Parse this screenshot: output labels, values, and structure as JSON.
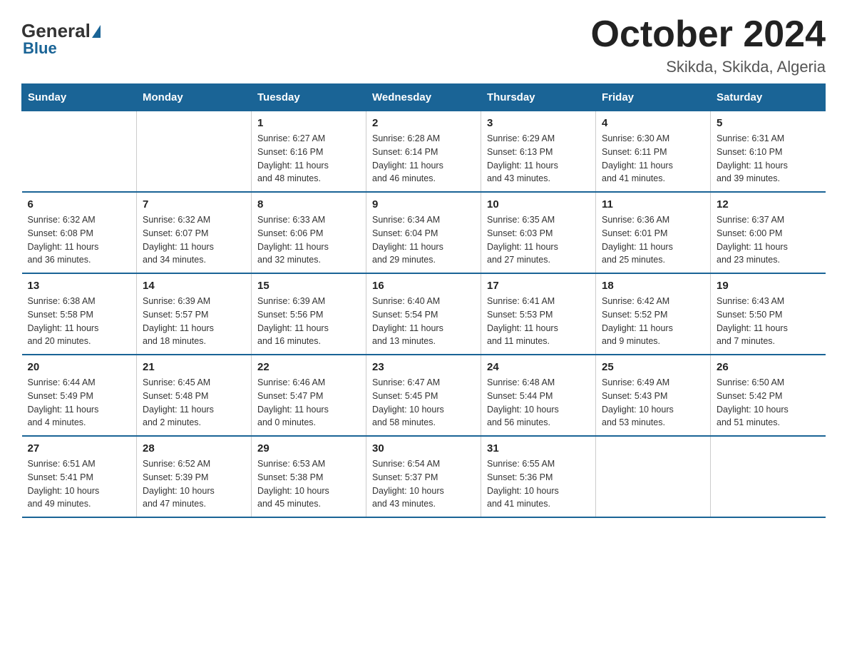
{
  "logo": {
    "general": "General",
    "blue": "Blue"
  },
  "title": {
    "month_year": "October 2024",
    "location": "Skikda, Skikda, Algeria"
  },
  "header_days": [
    "Sunday",
    "Monday",
    "Tuesday",
    "Wednesday",
    "Thursday",
    "Friday",
    "Saturday"
  ],
  "weeks": [
    [
      {
        "day": "",
        "info": ""
      },
      {
        "day": "",
        "info": ""
      },
      {
        "day": "1",
        "info": "Sunrise: 6:27 AM\nSunset: 6:16 PM\nDaylight: 11 hours\nand 48 minutes."
      },
      {
        "day": "2",
        "info": "Sunrise: 6:28 AM\nSunset: 6:14 PM\nDaylight: 11 hours\nand 46 minutes."
      },
      {
        "day": "3",
        "info": "Sunrise: 6:29 AM\nSunset: 6:13 PM\nDaylight: 11 hours\nand 43 minutes."
      },
      {
        "day": "4",
        "info": "Sunrise: 6:30 AM\nSunset: 6:11 PM\nDaylight: 11 hours\nand 41 minutes."
      },
      {
        "day": "5",
        "info": "Sunrise: 6:31 AM\nSunset: 6:10 PM\nDaylight: 11 hours\nand 39 minutes."
      }
    ],
    [
      {
        "day": "6",
        "info": "Sunrise: 6:32 AM\nSunset: 6:08 PM\nDaylight: 11 hours\nand 36 minutes."
      },
      {
        "day": "7",
        "info": "Sunrise: 6:32 AM\nSunset: 6:07 PM\nDaylight: 11 hours\nand 34 minutes."
      },
      {
        "day": "8",
        "info": "Sunrise: 6:33 AM\nSunset: 6:06 PM\nDaylight: 11 hours\nand 32 minutes."
      },
      {
        "day": "9",
        "info": "Sunrise: 6:34 AM\nSunset: 6:04 PM\nDaylight: 11 hours\nand 29 minutes."
      },
      {
        "day": "10",
        "info": "Sunrise: 6:35 AM\nSunset: 6:03 PM\nDaylight: 11 hours\nand 27 minutes."
      },
      {
        "day": "11",
        "info": "Sunrise: 6:36 AM\nSunset: 6:01 PM\nDaylight: 11 hours\nand 25 minutes."
      },
      {
        "day": "12",
        "info": "Sunrise: 6:37 AM\nSunset: 6:00 PM\nDaylight: 11 hours\nand 23 minutes."
      }
    ],
    [
      {
        "day": "13",
        "info": "Sunrise: 6:38 AM\nSunset: 5:58 PM\nDaylight: 11 hours\nand 20 minutes."
      },
      {
        "day": "14",
        "info": "Sunrise: 6:39 AM\nSunset: 5:57 PM\nDaylight: 11 hours\nand 18 minutes."
      },
      {
        "day": "15",
        "info": "Sunrise: 6:39 AM\nSunset: 5:56 PM\nDaylight: 11 hours\nand 16 minutes."
      },
      {
        "day": "16",
        "info": "Sunrise: 6:40 AM\nSunset: 5:54 PM\nDaylight: 11 hours\nand 13 minutes."
      },
      {
        "day": "17",
        "info": "Sunrise: 6:41 AM\nSunset: 5:53 PM\nDaylight: 11 hours\nand 11 minutes."
      },
      {
        "day": "18",
        "info": "Sunrise: 6:42 AM\nSunset: 5:52 PM\nDaylight: 11 hours\nand 9 minutes."
      },
      {
        "day": "19",
        "info": "Sunrise: 6:43 AM\nSunset: 5:50 PM\nDaylight: 11 hours\nand 7 minutes."
      }
    ],
    [
      {
        "day": "20",
        "info": "Sunrise: 6:44 AM\nSunset: 5:49 PM\nDaylight: 11 hours\nand 4 minutes."
      },
      {
        "day": "21",
        "info": "Sunrise: 6:45 AM\nSunset: 5:48 PM\nDaylight: 11 hours\nand 2 minutes."
      },
      {
        "day": "22",
        "info": "Sunrise: 6:46 AM\nSunset: 5:47 PM\nDaylight: 11 hours\nand 0 minutes."
      },
      {
        "day": "23",
        "info": "Sunrise: 6:47 AM\nSunset: 5:45 PM\nDaylight: 10 hours\nand 58 minutes."
      },
      {
        "day": "24",
        "info": "Sunrise: 6:48 AM\nSunset: 5:44 PM\nDaylight: 10 hours\nand 56 minutes."
      },
      {
        "day": "25",
        "info": "Sunrise: 6:49 AM\nSunset: 5:43 PM\nDaylight: 10 hours\nand 53 minutes."
      },
      {
        "day": "26",
        "info": "Sunrise: 6:50 AM\nSunset: 5:42 PM\nDaylight: 10 hours\nand 51 minutes."
      }
    ],
    [
      {
        "day": "27",
        "info": "Sunrise: 6:51 AM\nSunset: 5:41 PM\nDaylight: 10 hours\nand 49 minutes."
      },
      {
        "day": "28",
        "info": "Sunrise: 6:52 AM\nSunset: 5:39 PM\nDaylight: 10 hours\nand 47 minutes."
      },
      {
        "day": "29",
        "info": "Sunrise: 6:53 AM\nSunset: 5:38 PM\nDaylight: 10 hours\nand 45 minutes."
      },
      {
        "day": "30",
        "info": "Sunrise: 6:54 AM\nSunset: 5:37 PM\nDaylight: 10 hours\nand 43 minutes."
      },
      {
        "day": "31",
        "info": "Sunrise: 6:55 AM\nSunset: 5:36 PM\nDaylight: 10 hours\nand 41 minutes."
      },
      {
        "day": "",
        "info": ""
      },
      {
        "day": "",
        "info": ""
      }
    ]
  ]
}
